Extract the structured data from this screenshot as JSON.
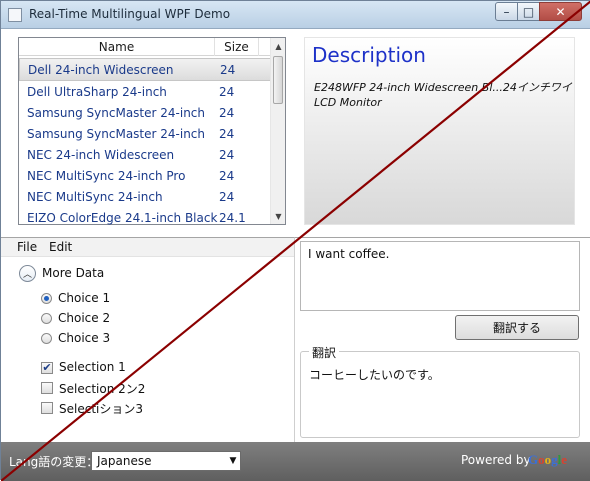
{
  "window": {
    "title": "Real-Time Multilingual WPF Demo",
    "controls": {
      "minimize": "–",
      "maximize": "□",
      "close": "✕"
    }
  },
  "product_list": {
    "columns": {
      "name": "Name",
      "size": "Size"
    },
    "rows": [
      {
        "name": "Dell 24-inch Widescreen",
        "size": "24"
      },
      {
        "name": "Dell UltraSharp 24-inch",
        "size": "24"
      },
      {
        "name": "Samsung SyncMaster 24-inch",
        "size": "24"
      },
      {
        "name": "Samsung SyncMaster 24-inch",
        "size": "24"
      },
      {
        "name": "NEC 24-inch Widescreen",
        "size": "24"
      },
      {
        "name": "NEC MultiSync 24-inch Pro",
        "size": "24"
      },
      {
        "name": "NEC MultiSync 24-inch",
        "size": "24"
      },
      {
        "name": "EIZO ColorEdge 24.1-inch Black",
        "size": "24.1"
      }
    ],
    "selected_index": 0,
    "scroll": {
      "up": "▲",
      "down": "▼"
    }
  },
  "description": {
    "title": "Description",
    "text": "E248WFP 24-inch Widescreen Bl...24インチワイLCD Monitor"
  },
  "menu": {
    "file": "File",
    "edit": "Edit"
  },
  "expander": {
    "label": "More Data",
    "icon": "chevron-up-icon",
    "glyph": "︿"
  },
  "choices": [
    {
      "label": "Choice 1",
      "checked": true
    },
    {
      "label": "Choice 2",
      "checked": false
    },
    {
      "label": "Choice 3",
      "checked": false
    }
  ],
  "selections": [
    {
      "label": "Selection 1",
      "checked": true
    },
    {
      "label": "Selection 2ン2",
      "checked": false
    },
    {
      "label": "Selectiション3",
      "checked": false
    }
  ],
  "translation": {
    "source_text": "I want coffee.",
    "button_label": "翻訳する",
    "result_legend": "翻訳",
    "result_text": "コーヒーしたいのです。"
  },
  "statusbar": {
    "language_label": "Lang語の変更：",
    "language_selected": "Japanese",
    "powered_by": "Powered by",
    "google_letters": [
      "G",
      "o",
      "o",
      "g",
      "l",
      "e"
    ],
    "google_colors": [
      "#3b6fd8",
      "#d9422f",
      "#e7b416",
      "#3b6fd8",
      "#2e9a3e",
      "#d9422f"
    ]
  },
  "colors": {
    "overlay_line": "#8b0000",
    "accent_title": "#1d31c8",
    "list_text": "#1a3a8a"
  }
}
